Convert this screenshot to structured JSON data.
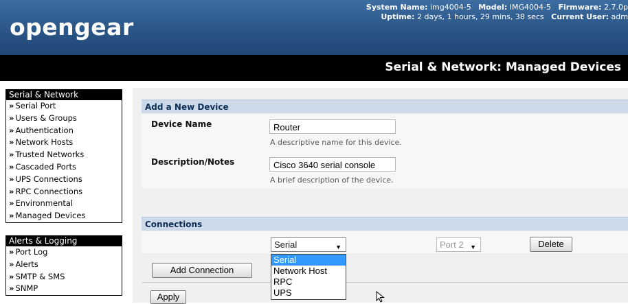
{
  "header": {
    "logo": "opengear",
    "system_name_label": "System Name:",
    "system_name": "img4004-5",
    "model_label": "Model:",
    "model": "IMG4004-5",
    "firmware_label": "Firmware:",
    "firmware": "2.7.0p",
    "uptime_label": "Uptime:",
    "uptime": "2 days, 1 hours, 29 mins, 38 secs",
    "current_user_label": "Current User:",
    "current_user": "adm"
  },
  "page_title": "Serial & Network: Managed Devices",
  "sidebar": {
    "sections": [
      {
        "title": "Serial & Network",
        "items": [
          "Serial Port",
          "Users & Groups",
          "Authentication",
          "Network Hosts",
          "Trusted Networks",
          "Cascaded Ports",
          "UPS Connections",
          "RPC Connections",
          "Environmental",
          "Managed Devices"
        ]
      },
      {
        "title": "Alerts & Logging",
        "items": [
          "Port Log",
          "Alerts",
          "SMTP & SMS",
          "SNMP"
        ]
      }
    ],
    "arrow": "»"
  },
  "add_device": {
    "section_title": "Add a New Device",
    "device_name_label": "Device Name",
    "device_name_value": "Router",
    "device_name_hint": "A descriptive name for this device.",
    "description_label": "Description/Notes",
    "description_value": "Cisco 3640 serial console",
    "description_hint": "A brief description of the device."
  },
  "connections": {
    "section_title": "Connections",
    "type_selected": "Serial",
    "type_options": [
      "Serial",
      "Network Host",
      "RPC",
      "UPS"
    ],
    "port_selected": "Port 2",
    "delete_label": "Delete",
    "add_connection_label": "Add Connection",
    "apply_label": "Apply"
  }
}
